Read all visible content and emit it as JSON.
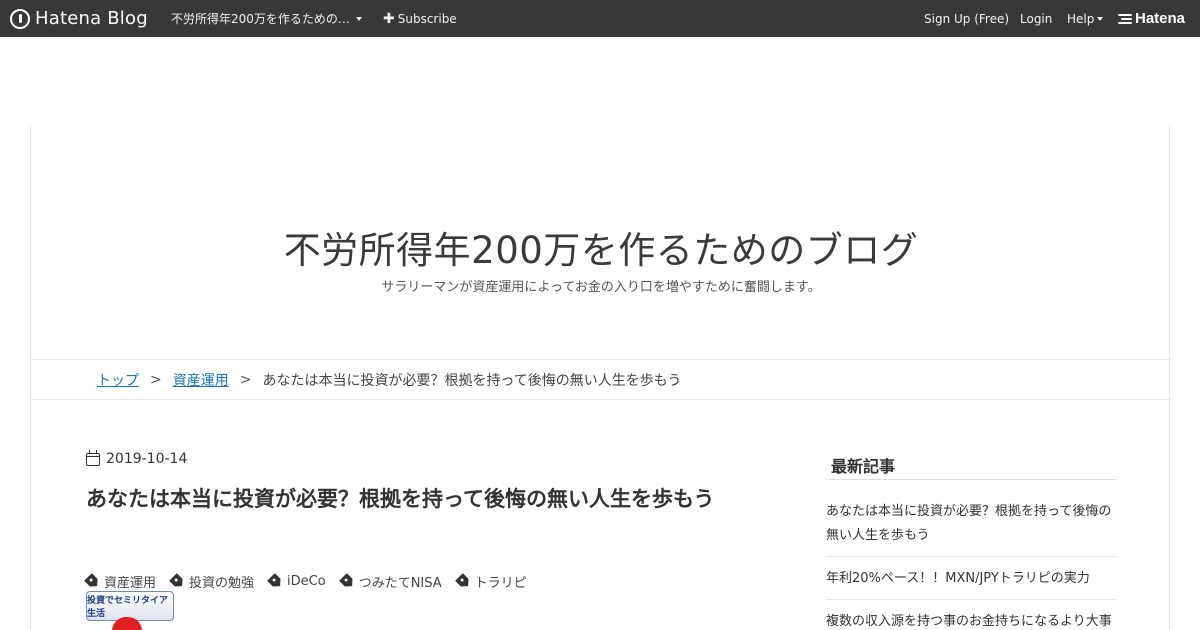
{
  "topbar": {
    "brand": "Hatena Blog",
    "blog_selector": "不労所得年200万を作るための…",
    "subscribe": "Subscribe",
    "signup": "Sign Up (Free)",
    "login": "Login",
    "help": "Help",
    "hatena": "Hatena"
  },
  "header": {
    "title": "不労所得年200万を作るためのブログ",
    "description": "サラリーマンが資産運用によってお金の入り口を増やすために奮闘します。"
  },
  "breadcrumb": {
    "top": "トップ",
    "separator": ">",
    "category": "資産運用",
    "current": "あなたは本当に投資が必要？根拠を持って後悔の無い人生を歩もう"
  },
  "entry": {
    "date": "2019-10-14",
    "title": "あなたは本当に投資が必要？根拠を持って後悔の無い人生を歩もう",
    "tags": [
      "資産運用",
      "投資の勉強",
      "iDeCo",
      "つみたてNISA",
      "トラリピ"
    ],
    "banner_text": "投資でセミリタイア生活"
  },
  "sidebar": {
    "recent_heading": "最新記事",
    "recent": [
      "あなたは本当に投資が必要？根拠を持って後悔の無い人生を歩もう",
      "年利20%ペース！！MXN/JPYトラリピの実力",
      "複数の収入源を持つ事のお金持ちになるより大事"
    ]
  }
}
